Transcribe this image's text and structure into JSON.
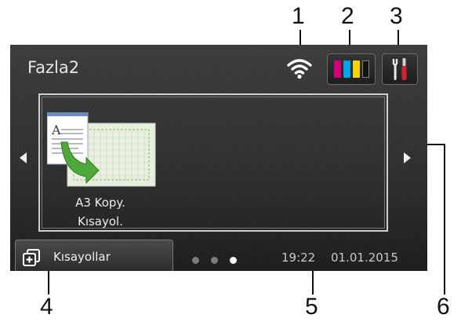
{
  "callouts": [
    "1",
    "2",
    "3",
    "4",
    "5",
    "6"
  ],
  "header": {
    "title": "Fazla2",
    "wifi_icon": "wifi-icon",
    "ink_icon": "ink-toner-icon",
    "settings_icon": "settings-tools-icon",
    "ink_colors": [
      "#d4007a",
      "#00a3e6",
      "#f2d400",
      "#222222"
    ]
  },
  "shortcut": {
    "icon": "a3-copy-icon",
    "label_line1": "A3 Kopy.",
    "label_line2": "Kısayol."
  },
  "nav": {
    "left_icon": "arrow-left-icon",
    "right_icon": "arrow-right-icon"
  },
  "footer": {
    "shortcuts_label": "Kısayollar",
    "shortcuts_icon": "shortcuts-icon",
    "page_dots": 3,
    "active_dot": 3,
    "time": "19:22",
    "date": "01.01.2015"
  }
}
